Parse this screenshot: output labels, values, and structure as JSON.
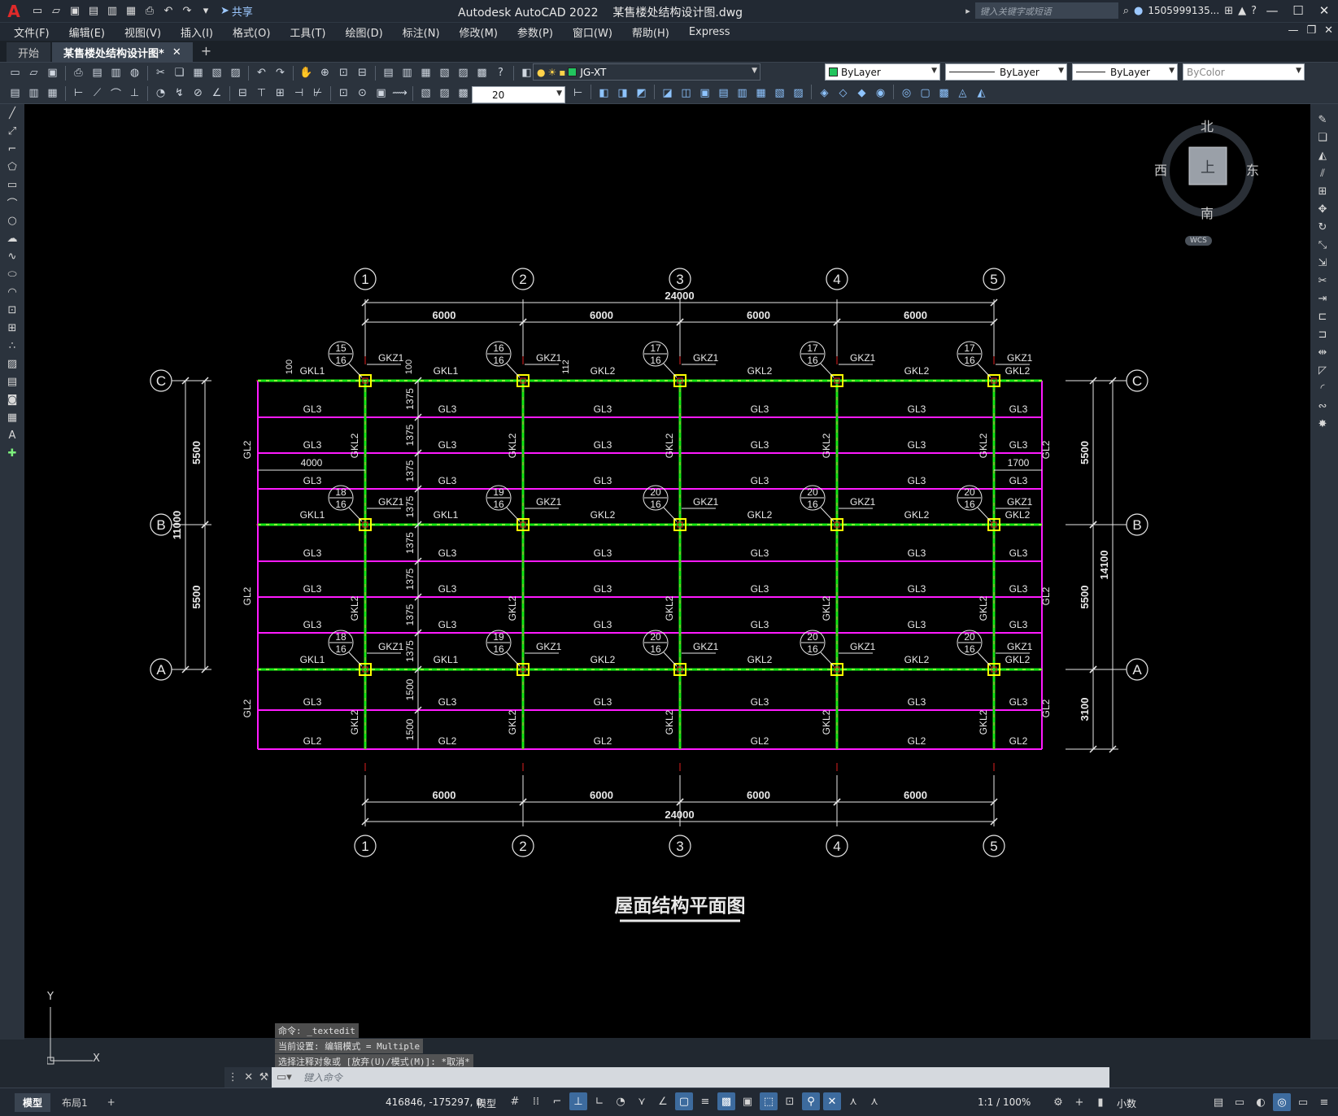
{
  "app": {
    "logo": "A",
    "title": "Autodesk AutoCAD 2022    某售楼处结构设计图.dwg",
    "share": "共享",
    "search_placeholder": "键入关键字或短语",
    "user": "1505999135...",
    "win_min": "—",
    "win_max": "☐",
    "win_close": "✕"
  },
  "menu": [
    "文件(F)",
    "编辑(E)",
    "视图(V)",
    "插入(I)",
    "格式(O)",
    "工具(T)",
    "绘图(D)",
    "标注(N)",
    "修改(M)",
    "参数(P)",
    "窗口(W)",
    "帮助(H)",
    "Express"
  ],
  "tabs": [
    {
      "label": "开始",
      "active": false
    },
    {
      "label": "某售楼处结构设计图*",
      "active": true
    }
  ],
  "tab_close": "✕",
  "tab_add": "+",
  "toolbar": {
    "layer": "JG-XT",
    "layer_color": "#22c55e",
    "color": "ByLayer",
    "linetype": "ByLayer",
    "lineweight": "ByLayer",
    "plotstyle": "ByColor",
    "dimscale": "20"
  },
  "viewcube": {
    "north": "北",
    "south": "南",
    "east": "东",
    "west": "西",
    "top": "上",
    "wcs": "WCS"
  },
  "command": {
    "history": [
      "命令: _textedit",
      "当前设置: 编辑模式 = Multiple",
      "选择注释对象或 [放弃(U)/模式(M)]: *取消*"
    ],
    "placeholder": "键入命令"
  },
  "status": {
    "layout_tabs": [
      {
        "label": "模型",
        "active": true
      },
      {
        "label": "布局1",
        "active": false
      }
    ],
    "add": "+",
    "coords": "416846, -175297, 0",
    "model": "模型",
    "scale": "1:1 / 100%",
    "units": "小数"
  },
  "ucs": {
    "x": "X",
    "y": "Y"
  },
  "drawing": {
    "title": "屋面结构平面图",
    "grid_x": [
      "1",
      "2",
      "3",
      "4",
      "5"
    ],
    "grid_y": [
      "C",
      "B",
      "A"
    ],
    "top_dims": [
      "6000",
      "6000",
      "6000",
      "6000"
    ],
    "top_total": "24000",
    "bottom_dims": [
      "6000",
      "6000",
      "6000",
      "6000"
    ],
    "bottom_total": "24000",
    "left_dims": [
      "5500",
      "5500"
    ],
    "left_total": "11000",
    "right_dims": [
      "5500",
      "5500",
      "3100"
    ],
    "right_total": "14100",
    "mid_dims": [
      "1375",
      "1375",
      "1375",
      "1375",
      "1375",
      "1375",
      "1375",
      "1375",
      "1500",
      "1500"
    ],
    "edge_dims": [
      "100",
      "100",
      "112"
    ],
    "offset_dims": [
      "4000",
      "1700"
    ],
    "column_label": "GKZ1",
    "column_tags": [
      [
        [
          "15",
          "16"
        ],
        [
          "16",
          "16"
        ],
        [
          "17",
          "16"
        ],
        [
          "17",
          "16"
        ],
        [
          "17",
          "16"
        ]
      ],
      [
        [
          "18",
          "16"
        ],
        [
          "19",
          "16"
        ],
        [
          "20",
          "16"
        ],
        [
          "20",
          "16"
        ],
        [
          "20",
          "16"
        ]
      ],
      [
        [
          "18",
          "16"
        ],
        [
          "19",
          "16"
        ],
        [
          "20",
          "16"
        ],
        [
          "20",
          "16"
        ],
        [
          "20",
          "16"
        ]
      ]
    ],
    "beam_labels_row": [
      "GKL1",
      "GKL1",
      "GKL2",
      "GKL2",
      "GKL2",
      "GKL2"
    ],
    "vbeam_label": "GKL2",
    "edge_beam": "GL2",
    "secondary": "GL3"
  }
}
